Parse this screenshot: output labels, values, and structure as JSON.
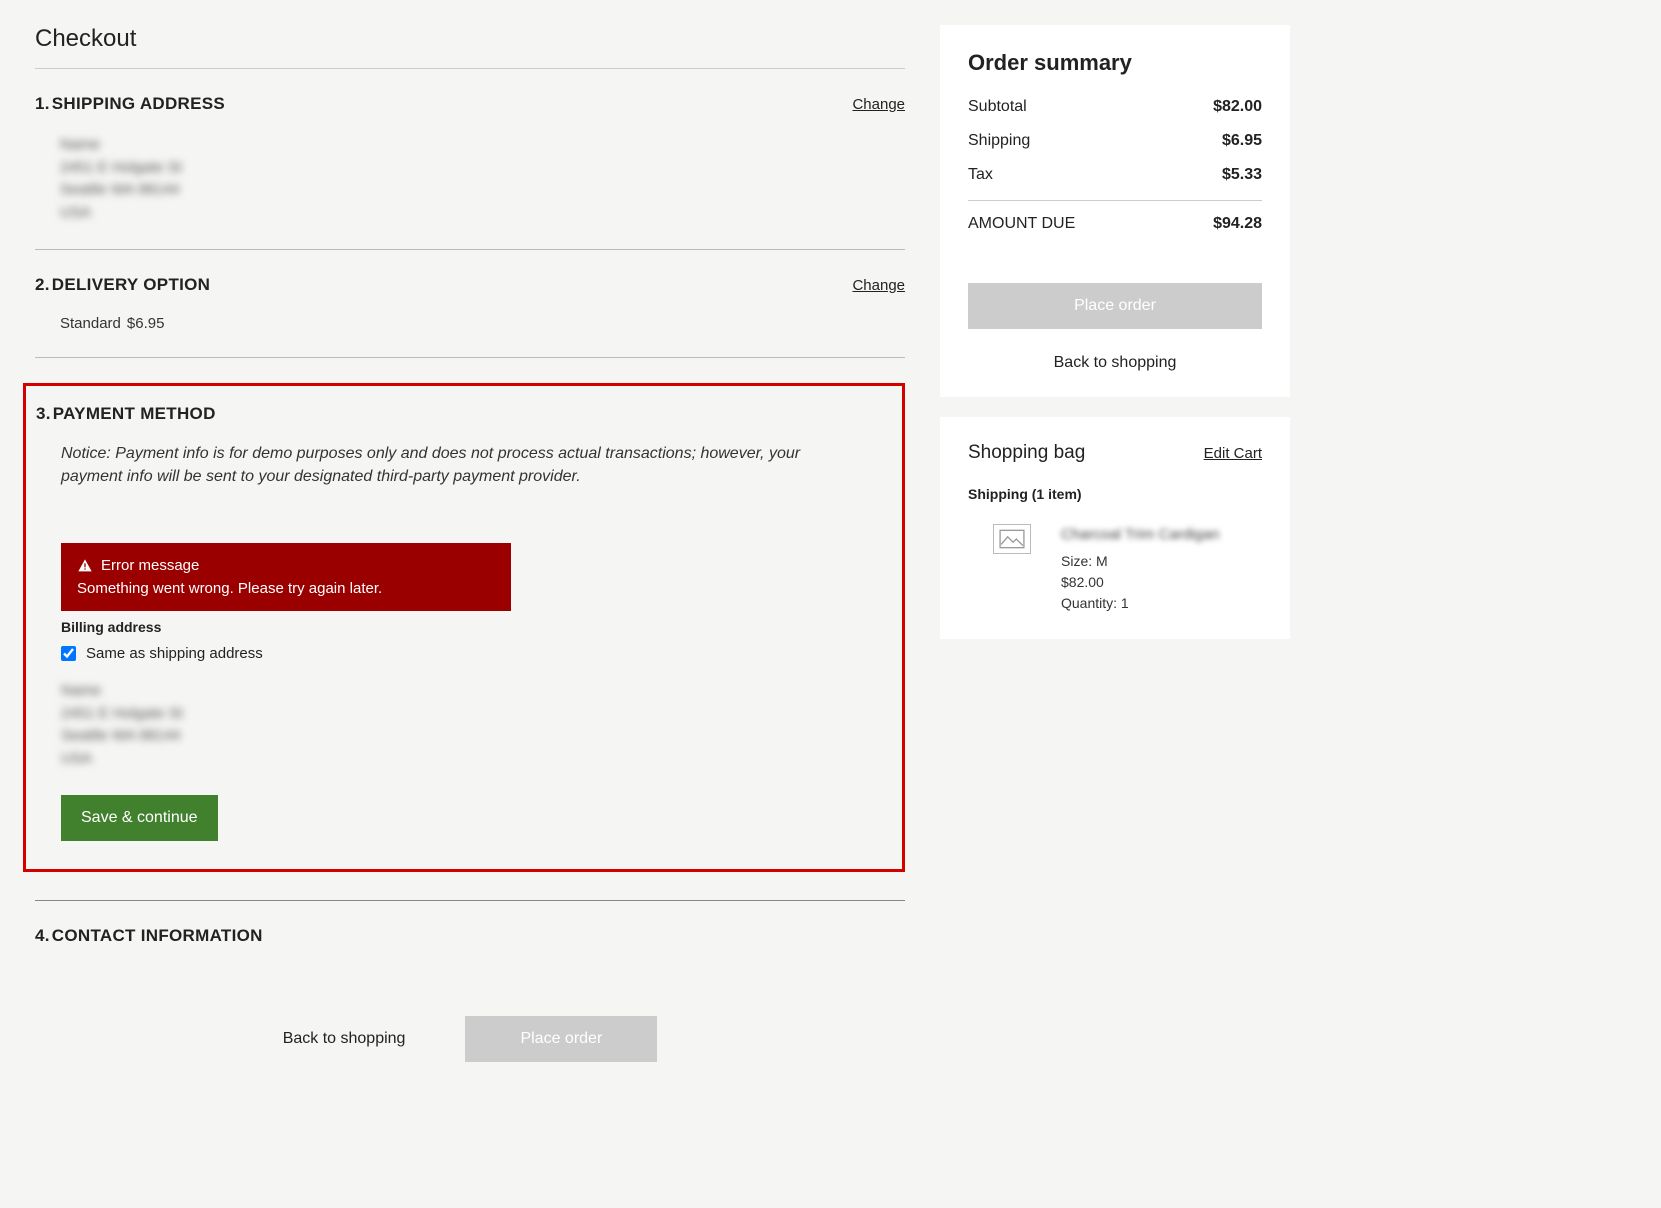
{
  "page_title": "Checkout",
  "sections": {
    "shipping": {
      "num": "1.",
      "title": "SHIPPING ADDRESS",
      "change": "Change"
    },
    "delivery": {
      "num": "2.",
      "title": "DELIVERY OPTION",
      "change": "Change",
      "method": "Standard",
      "price": "$6.95"
    },
    "payment": {
      "num": "3.",
      "title": "PAYMENT METHOD",
      "notice": "Notice: Payment info is for demo purposes only and does not process actual transactions; however, your payment info will be sent to your designated third-party payment provider.",
      "error_title": "Error message",
      "error_detail": "Something went wrong. Please try again later.",
      "billing_label": "Billing address",
      "same_as_shipping": "Same as shipping address",
      "save_btn": "Save & continue"
    },
    "contact": {
      "num": "4.",
      "title": "CONTACT INFORMATION"
    }
  },
  "bottom": {
    "back": "Back to shopping",
    "place": "Place order"
  },
  "summary": {
    "title": "Order summary",
    "rows": {
      "subtotal": {
        "label": "Subtotal",
        "value": "$82.00"
      },
      "shipping": {
        "label": "Shipping",
        "value": "$6.95"
      },
      "tax": {
        "label": "Tax",
        "value": "$5.33"
      }
    },
    "total": {
      "label": "AMOUNT DUE",
      "value": "$94.28"
    },
    "place_btn": "Place order",
    "back": "Back to shopping"
  },
  "bag": {
    "title": "Shopping bag",
    "edit": "Edit Cart",
    "shipping_line": "Shipping (1 item)",
    "item": {
      "size": "Size: M",
      "price": "$82.00",
      "qty": "Quantity: 1"
    }
  },
  "blur_placeholder": {
    "l1": "Name",
    "l2": "2451 E Holgate St",
    "l3": "Seattle WA  98144",
    "l4": "USA"
  },
  "blur_item_name": "Charcoal Trim Cardigan"
}
